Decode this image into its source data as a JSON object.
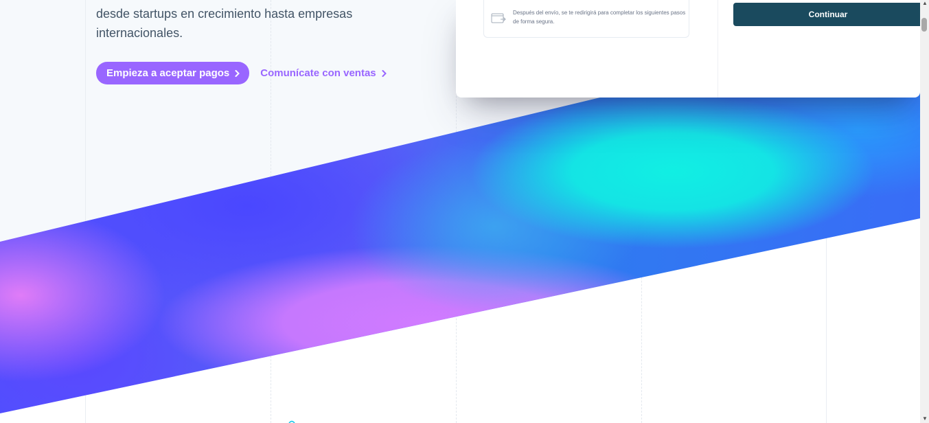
{
  "hero": {
    "description": "desde startups en crecimiento hasta empresas internacionales."
  },
  "cta": {
    "primary_label": "Empieza a aceptar pagos",
    "secondary_label": "Comunícate con ventas"
  },
  "payment_card": {
    "redirect_notice": "Después del envío, se te redirigirá para completar los siguientes pasos de forma segura.",
    "continue_label": "Continuar"
  },
  "colors": {
    "accent": "#9966ff",
    "continue_button": "#1a4a5e",
    "text": "#425466"
  },
  "icons": {
    "cta_chevron": "chevron-right-icon",
    "redirect": "browser-redirect-icon"
  }
}
